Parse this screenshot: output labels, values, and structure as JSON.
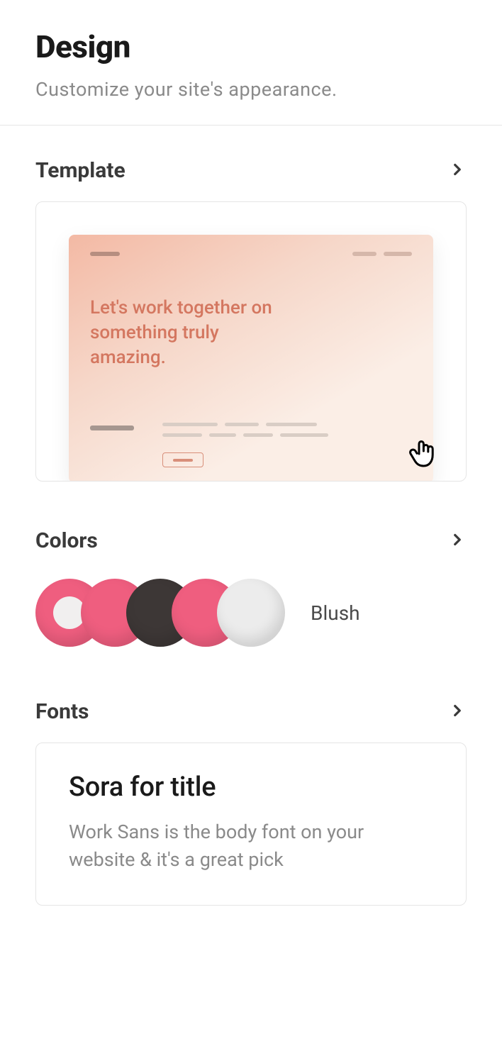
{
  "header": {
    "title": "Design",
    "subtitle": "Customize your site's appearance."
  },
  "template": {
    "section_label": "Template",
    "preview_heading": "Let's work together on something truly amazing."
  },
  "colors": {
    "section_label": "Colors",
    "palette_name": "Blush",
    "swatches": [
      "#ef5e7f",
      "#ef5e7f",
      "#3d3736",
      "#ef5e7f",
      "#ececec"
    ]
  },
  "fonts": {
    "section_label": "Fonts",
    "title_sample": "Sora for title",
    "body_sample": "Work Sans is the body font on your website & it's a great pick"
  }
}
